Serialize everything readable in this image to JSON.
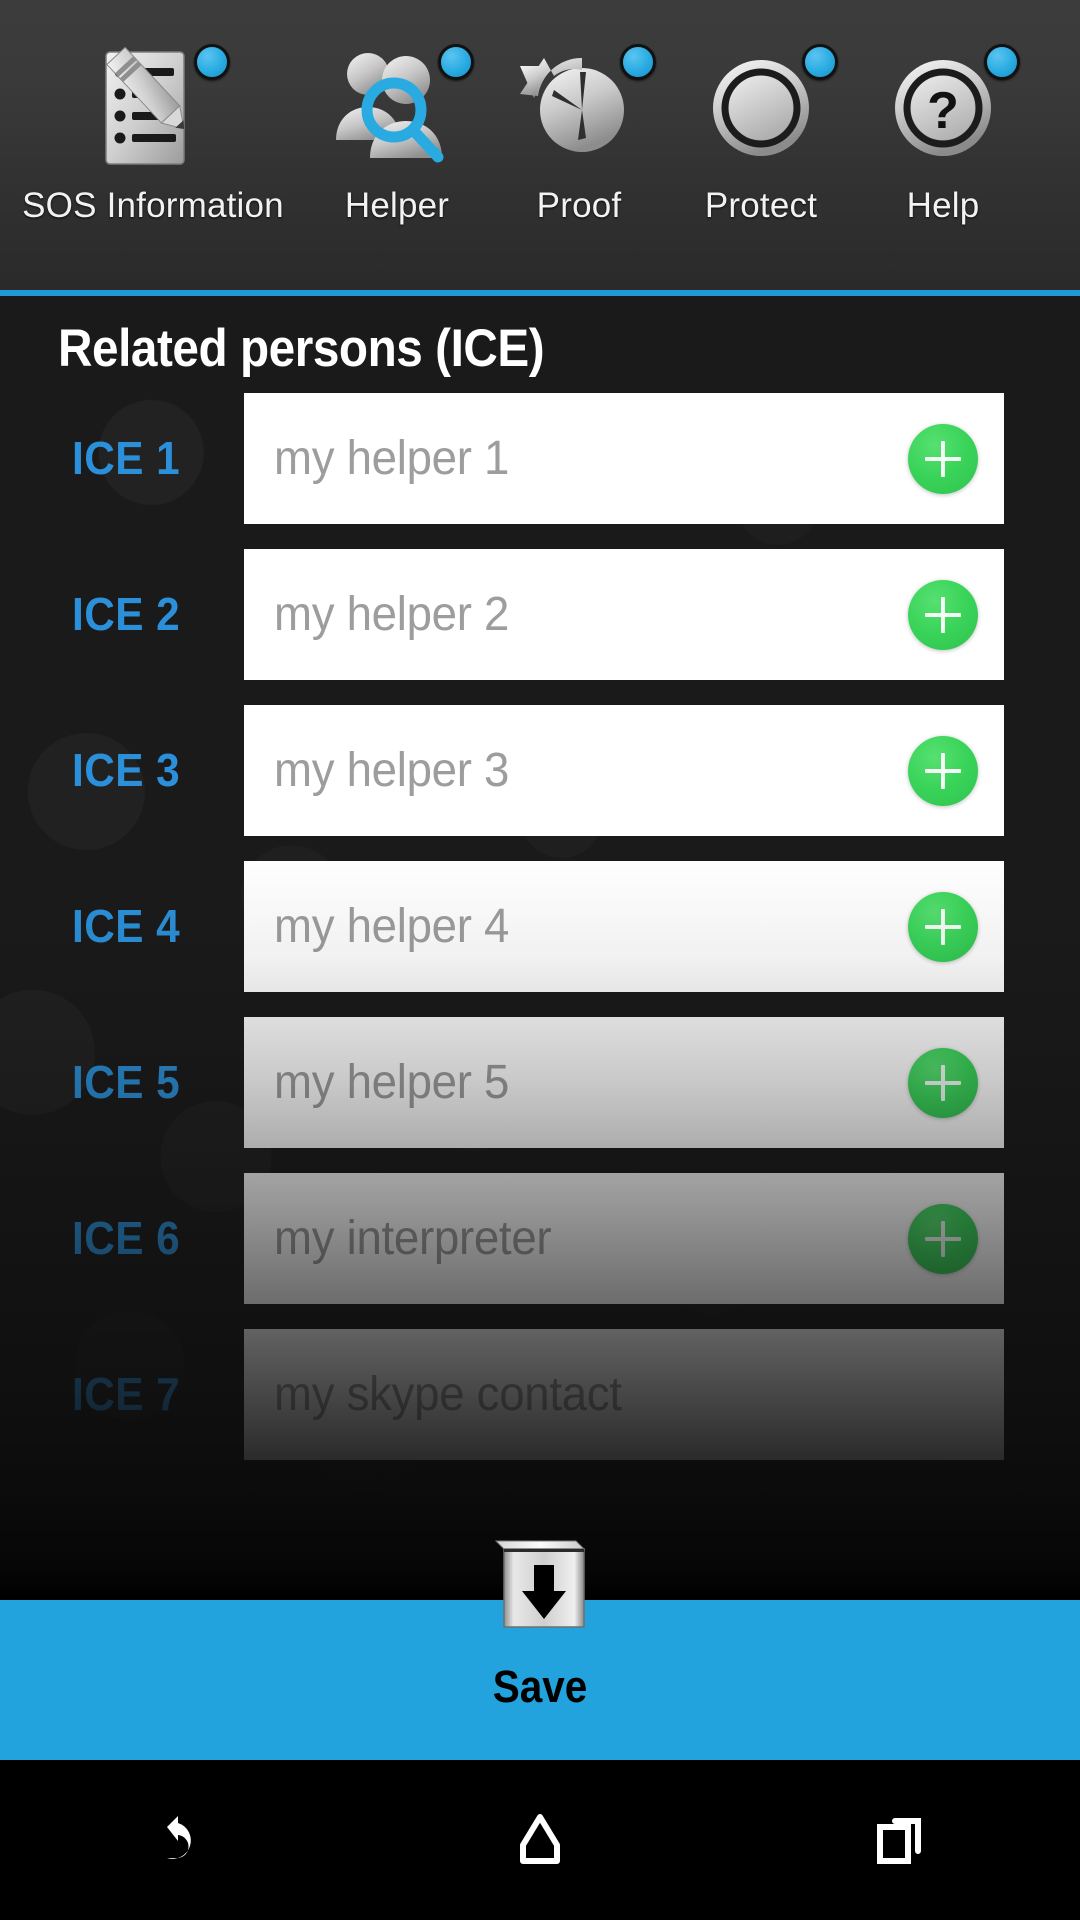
{
  "topbar": {
    "tabs": [
      {
        "label": "SOS Information",
        "icon": "form-pencil-icon",
        "badge": true
      },
      {
        "label": "Helper",
        "icon": "person-search-icon",
        "badge": true
      },
      {
        "label": "Proof",
        "icon": "clock-undo-icon",
        "badge": true
      },
      {
        "label": "Protect",
        "icon": "shield-ring-icon",
        "badge": true
      },
      {
        "label": "Help",
        "icon": "question-circle-icon",
        "badge": true
      }
    ]
  },
  "content": {
    "title": "Related persons (ICE)",
    "rows": [
      {
        "label": "ICE 1",
        "placeholder": "my helper 1",
        "has_add": true
      },
      {
        "label": "ICE 2",
        "placeholder": "my helper 2",
        "has_add": true
      },
      {
        "label": "ICE 3",
        "placeholder": "my helper 3",
        "has_add": true
      },
      {
        "label": "ICE 4",
        "placeholder": "my helper 4",
        "has_add": true
      },
      {
        "label": "ICE 5",
        "placeholder": "my helper 5",
        "has_add": true
      },
      {
        "label": "ICE 6",
        "placeholder": "my interpreter",
        "has_add": true
      },
      {
        "label": "ICE 7",
        "placeholder": "my skype contact",
        "has_add": false
      }
    ]
  },
  "save": {
    "label": "Save",
    "icon": "save-box-down-arrow-icon"
  },
  "navbar": {
    "back": "back-icon",
    "home": "home-icon",
    "recents": "recents-icon"
  },
  "colors": {
    "accent_blue": "#23a3dd",
    "label_blue": "#2b90d9",
    "add_green": "#3ad45a",
    "background_dark": "#1a1a1a",
    "topbar_grey": "#3a3a3a"
  }
}
